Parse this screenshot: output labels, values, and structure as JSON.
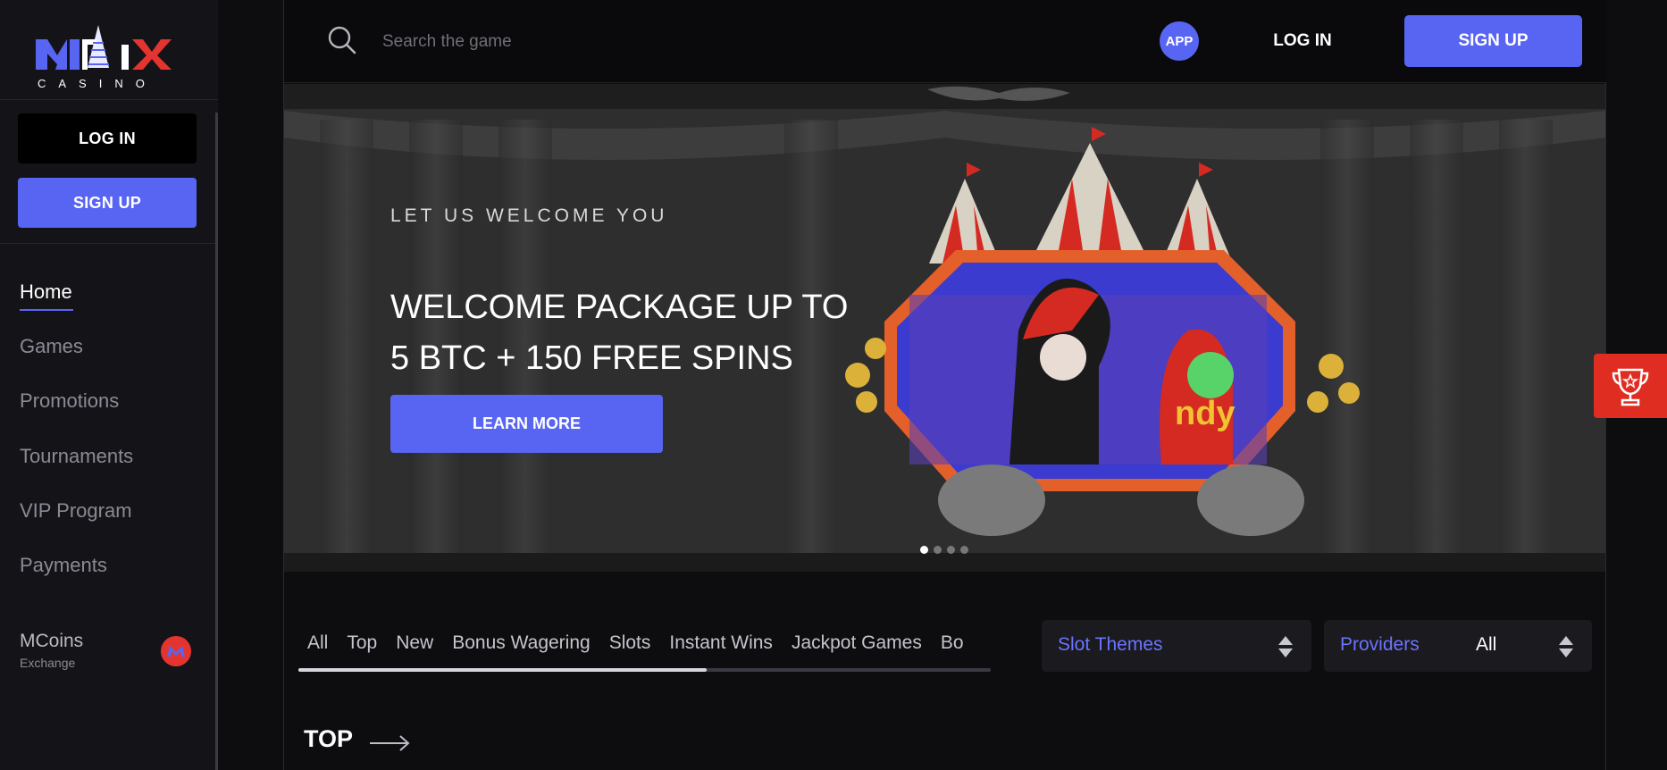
{
  "brand": {
    "name": "MIRAX",
    "sub": "CASINO"
  },
  "sidebar": {
    "login_label": "LOG IN",
    "signup_label": "SIGN UP",
    "items": [
      {
        "label": "Home"
      },
      {
        "label": "Games"
      },
      {
        "label": "Promotions"
      },
      {
        "label": "Tournaments"
      },
      {
        "label": "VIP Program"
      },
      {
        "label": "Payments"
      }
    ],
    "mcoins": {
      "label": "MCoins",
      "sub": "Exchange"
    }
  },
  "header": {
    "search_placeholder": "Search the game",
    "app_label": "APP",
    "login_label": "LOG IN",
    "signup_label": "SIGN UP"
  },
  "hero": {
    "eyebrow": "LET US WELCOME YOU",
    "title_line1": "WELCOME PACKAGE UP TO",
    "title_line2": "5 BTC + 150 FREE SPINS",
    "button_label": "LEARN MORE",
    "slides": 4,
    "active_slide": 1
  },
  "filters": {
    "tabs": [
      "All",
      "Top",
      "New",
      "Bonus Wagering",
      "Slots",
      "Instant Wins",
      "Jackpot Games",
      "Bo"
    ],
    "slot_themes_label": "Slot Themes",
    "providers_label": "Providers",
    "providers_value": "All"
  },
  "section": {
    "title": "TOP"
  },
  "colors": {
    "accent": "#5865f2",
    "trophy": "#e02d22",
    "background": "#0d0d10"
  }
}
